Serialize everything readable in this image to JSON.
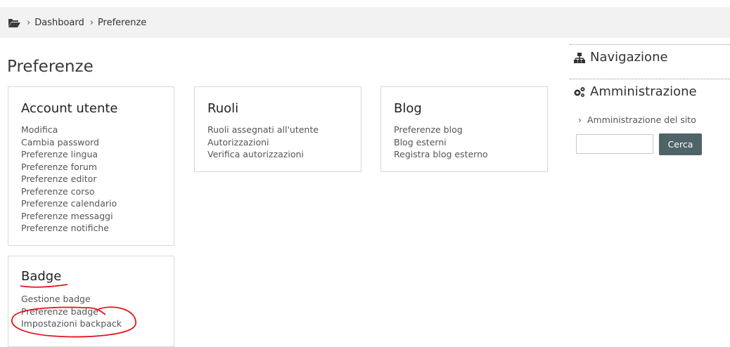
{
  "breadcrumb": {
    "items": [
      "Dashboard",
      "Preferenze"
    ]
  },
  "page": {
    "title": "Preferenze"
  },
  "cards": {
    "account": {
      "title": "Account utente",
      "links": [
        "Modifica",
        "Cambia password",
        "Preferenze lingua",
        "Preferenze forum",
        "Preferenze editor",
        "Preferenze corso",
        "Preferenze calendario",
        "Preferenze messaggi",
        "Preferenze notifiche"
      ]
    },
    "roles": {
      "title": "Ruoli",
      "links": [
        "Ruoli assegnati all'utente",
        "Autorizzazioni",
        "Verifica autorizzazioni"
      ]
    },
    "blog": {
      "title": "Blog",
      "links": [
        "Preferenze blog",
        "Blog esterni",
        "Registra blog esterno"
      ]
    },
    "badge": {
      "title": "Badge",
      "links": [
        "Gestione badge",
        "Preferenze badge",
        "Impostazioni backpack"
      ]
    }
  },
  "sidebar": {
    "navigation_title": "Navigazione",
    "admin_title": "Amministrazione",
    "admin_link": "Amministrazione del sito",
    "search_value": "",
    "search_button": "Cerca"
  },
  "colors": {
    "accent_button": "#4f6469",
    "annotation": "#e0161b"
  }
}
